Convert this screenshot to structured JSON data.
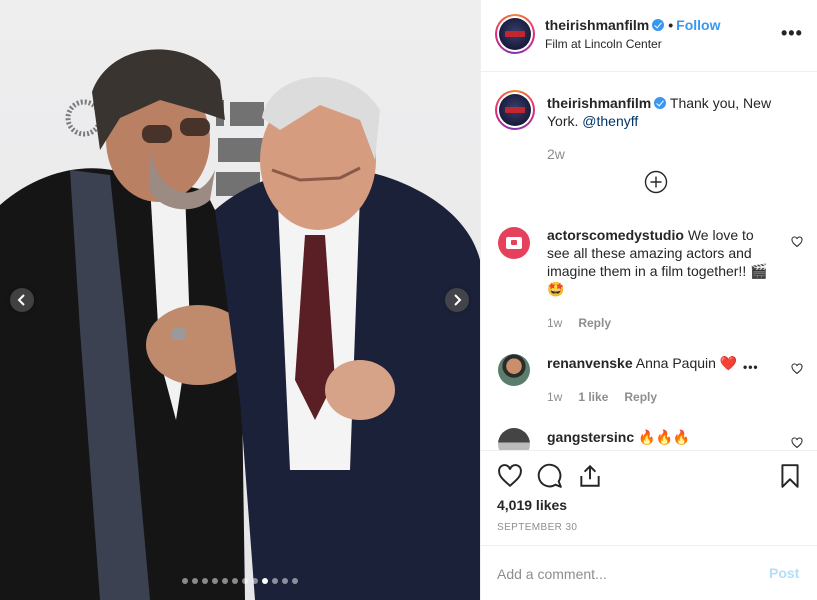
{
  "post": {
    "author": {
      "username": "theirishmanfilm",
      "verified": true,
      "follow_label": "Follow",
      "location": "Film at Lincoln Center",
      "separator": "•"
    },
    "more_options_label": "•••",
    "caption": {
      "username": "theirishmanfilm",
      "text": "Thank you, New York.",
      "mention": "@thenyff",
      "time": "2w"
    },
    "load_more_icon": "plus-circle-icon",
    "comments": [
      {
        "username": "actorscomedystudio",
        "text": "We love to see all these amazing actors and imagine them in a film together!! 🎬🤩",
        "time": "1w",
        "reply_label": "Reply"
      },
      {
        "username": "renanvenske",
        "text": "Anna Paquin ❤️",
        "time": "1w",
        "likes_label": "1 like",
        "reply_label": "Reply"
      },
      {
        "username": "gangstersinc",
        "text": "🔥🔥🔥"
      }
    ],
    "likes": "4,019 likes",
    "date": "SEPTEMBER 30",
    "add_comment_placeholder": "Add a comment...",
    "post_button_label": "Post",
    "carousel": {
      "slides": 12,
      "active_index": 8
    },
    "colors": {
      "link_blue": "#3897f0",
      "post_disabled": "#b2dffc",
      "muted": "#8e8e8e",
      "text": "#262626"
    }
  }
}
